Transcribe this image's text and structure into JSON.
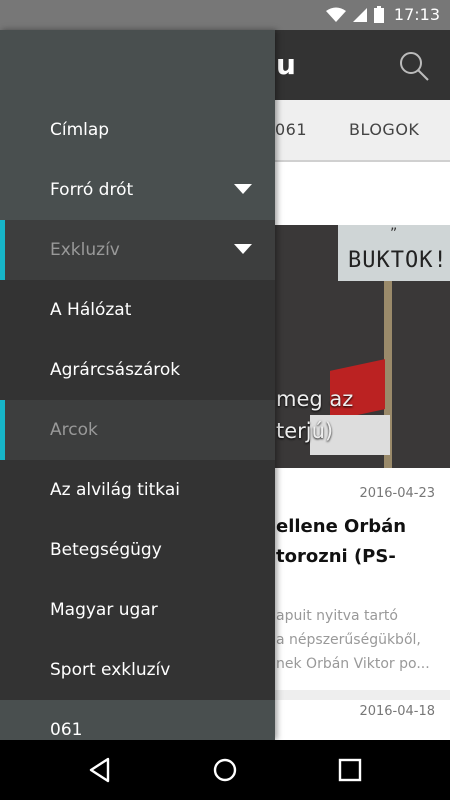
{
  "status_bar": {
    "time": "17:13"
  },
  "app": {
    "logo_fragment": "u",
    "tabs": [
      "061",
      "BLOGOK"
    ],
    "feature": {
      "sign_text": "BUKTOK!!",
      "sign_top": "”",
      "title_line1": "meg az",
      "title_line2": "terjú)"
    },
    "articles": [
      {
        "date": "2016-04-23",
        "title_line1": "ellene Orbán",
        "title_line2": "torozni (PS-",
        "snippet_line1": "apuit nyitva tartó",
        "snippet_line2": "a népszerűségükből,",
        "snippet_line3": "nek Orbán Viktor po..."
      },
      {
        "date": "2016-04-18"
      }
    ]
  },
  "drawer": {
    "items": [
      {
        "label": "Címlap"
      },
      {
        "label": "Forró drót"
      },
      {
        "label": "Exkluzív"
      },
      {
        "label": "A Hálózat"
      },
      {
        "label": "Agrárcsászárok"
      },
      {
        "label": "Arcok"
      },
      {
        "label": "Az alvilág titkai"
      },
      {
        "label": "Betegségügy"
      },
      {
        "label": "Magyar ugar"
      },
      {
        "label": "Sport exkluzív"
      },
      {
        "label": "061"
      }
    ]
  },
  "colors": {
    "accent": "#17b5c8",
    "drawer_bg": "#333333",
    "drawer_light": "#494f4f"
  }
}
